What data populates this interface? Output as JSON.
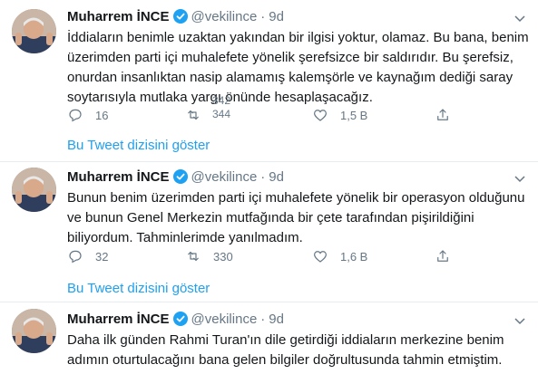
{
  "tweets": [
    {
      "name": "Muharrem İNCE",
      "handle": "@vekilince",
      "separator": "·",
      "time": "9d",
      "text": "İddiaların benimle uzaktan yakından bir ilgisi yoktur, olamaz. Bu bana, benim\nüzerimden parti içi muhalefete yönelik şerefsizce bir saldırıdır. Bu şerefsiz,\nonurdan insanlıktan nasip alamamış kalemşörle ve kaynağım dediği saray\nsoytarısıyla mutlaka yargı önünde hesaplaşacağız.",
      "replies": "16",
      "retweets_top": "342",
      "retweets": "344",
      "likes": "1,5 B",
      "thread_link": "Bu Tweet dizisini göster"
    },
    {
      "name": "Muharrem İNCE",
      "handle": "@vekilince",
      "separator": "·",
      "time": "9d",
      "text": "Bunun benim üzerimden parti içi muhalefete yönelik bir operasyon olduğunu\nve bunun Genel Merkezin mutfağında bir çete tarafından pişirildiğini\nbiliyordum. Tahminlerimde yanılmadım.",
      "replies": "32",
      "retweets": "330",
      "likes": "1,6 B",
      "thread_link": "Bu Tweet dizisini göster"
    },
    {
      "name": "Muharrem İNCE",
      "handle": "@vekilince",
      "separator": "·",
      "time": "9d",
      "text": "Daha ilk günden Rahmi Turan'ın dile getirdiği iddiaların merkezine benim\nadımın oturtulacağını bana gelen bilgiler doğrultusunda tahmin etmiştim."
    }
  ],
  "colors": {
    "link": "#1da1f2",
    "muted": "#657786",
    "text": "#14171a",
    "divider": "#e6ecf0"
  },
  "icons": [
    "verified-badge-icon",
    "chevron-down-icon",
    "reply-icon",
    "retweet-icon",
    "like-icon",
    "share-icon"
  ]
}
